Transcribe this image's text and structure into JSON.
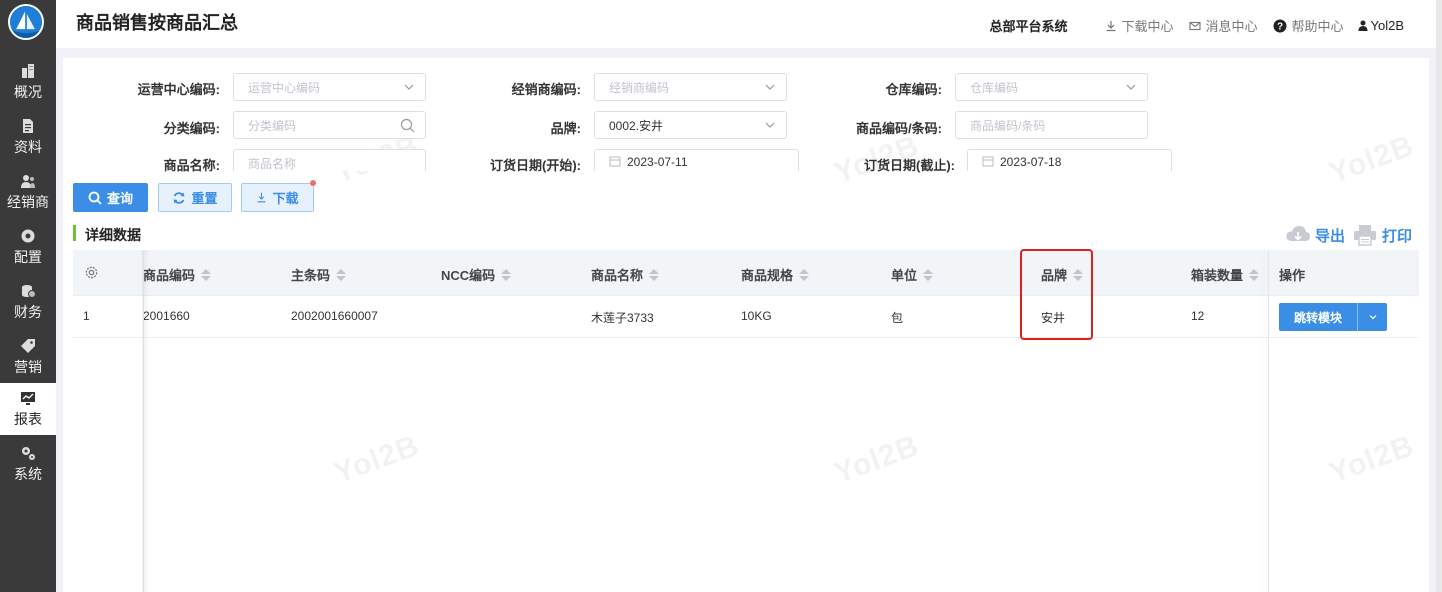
{
  "sidebar": {
    "logo_icon": "sailboat-logo-icon",
    "items": [
      {
        "label": "概况",
        "icon": "building-icon"
      },
      {
        "label": "资料",
        "icon": "document-icon"
      },
      {
        "label": "经销商",
        "icon": "users-icon"
      },
      {
        "label": "配置",
        "icon": "config-icon"
      },
      {
        "label": "财务",
        "icon": "coins-icon"
      },
      {
        "label": "营销",
        "icon": "tag-icon"
      },
      {
        "label": "报表",
        "icon": "chart-icon",
        "active": true
      },
      {
        "label": "系统",
        "icon": "gears-icon"
      }
    ]
  },
  "header": {
    "title": "商品销售按商品汇总",
    "system_name": "总部平台系统",
    "download_center": "下载中心",
    "message_center": "消息中心",
    "help_center": "帮助中心",
    "user": "Yol2B"
  },
  "watermark": "Yol2B",
  "filters": {
    "ops_center_code": {
      "label": "运营中心编码:",
      "placeholder": "运营中心编码"
    },
    "dealer_code": {
      "label": "经销商编码:",
      "placeholder": "经销商编码"
    },
    "warehouse_code": {
      "label": "仓库编码:",
      "placeholder": "仓库编码"
    },
    "category_code": {
      "label": "分类编码:",
      "placeholder": "分类编码"
    },
    "brand": {
      "label": "品牌:",
      "value": "0002.安井"
    },
    "product_code": {
      "label": "商品编码/条码:",
      "placeholder": "商品编码/条码"
    },
    "product_name": {
      "label": "商品名称:",
      "placeholder": "商品名称"
    },
    "order_date_start": {
      "label": "订货日期(开始):",
      "value": "2023-07-11"
    },
    "order_date_end": {
      "label": "订货日期(截止):",
      "value": "2023-07-18"
    }
  },
  "actions": {
    "query": "查询",
    "reset": "重置",
    "download": "下载"
  },
  "section": {
    "title": "详细数据",
    "export": "导出",
    "print": "打印"
  },
  "table": {
    "columns": [
      "商品编码",
      "主条码",
      "NCC编码",
      "商品名称",
      "商品规格",
      "单位",
      "品牌",
      "箱装数量",
      "操作"
    ],
    "rows": [
      {
        "index": "1",
        "product_code": "2001660",
        "barcode": "2002001660007",
        "ncc_code": "",
        "product_name": "木莲子3733",
        "spec": "10KG",
        "unit": "包",
        "brand": "安井",
        "case_qty": "12",
        "action": "跳转模块"
      }
    ]
  },
  "colors": {
    "primary": "#3a8ee6",
    "sidebar_bg": "#3a3a3a",
    "highlight": "#e02020",
    "section_marker": "#67c23a"
  }
}
